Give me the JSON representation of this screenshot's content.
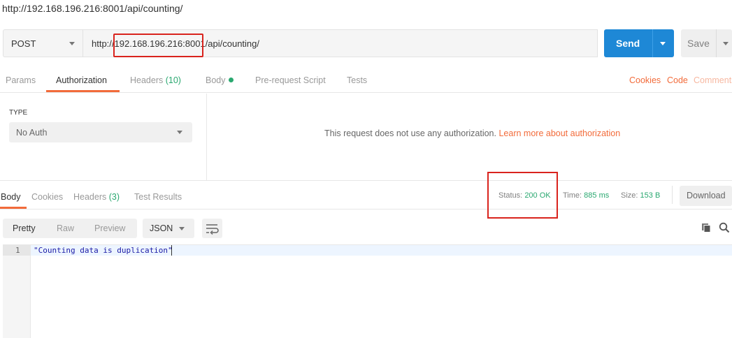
{
  "title_bar": {
    "text": "http://192.168.196.216:8001/api/counting/"
  },
  "request": {
    "method": "POST",
    "url_prefix": "http://",
    "url_host": "192.168.196.216:8001",
    "url_path": "/api/counting/",
    "send_label": "Send",
    "save_label": "Save"
  },
  "request_tabs": {
    "params": "Params",
    "authorization": "Authorization",
    "headers": "Headers",
    "headers_count": "(10)",
    "body": "Body",
    "prerequest": "Pre-request Script",
    "tests": "Tests",
    "cookies": "Cookies",
    "code": "Code",
    "comments": "Comments"
  },
  "auth": {
    "type_label": "TYPE",
    "type_value": "No Auth",
    "message": "This request does not use any authorization.",
    "learn_more": "Learn more about authorization"
  },
  "response_tabs": {
    "body": "Body",
    "cookies": "Cookies",
    "headers": "Headers",
    "headers_count": "(3)",
    "test_results": "Test Results"
  },
  "response_meta": {
    "status_label": "Status:",
    "status_value": "200 OK",
    "time_label": "Time:",
    "time_value": "885 ms",
    "size_label": "Size:",
    "size_value": "153 B",
    "download_label": "Download"
  },
  "view_toolbar": {
    "pretty": "Pretty",
    "raw": "Raw",
    "preview": "Preview",
    "format": "JSON"
  },
  "editor": {
    "lines": [
      {
        "number": "1",
        "text": "\"Counting data is duplication\""
      }
    ]
  },
  "colors": {
    "accent": "#f26b3a",
    "send_blue": "#1e88d6",
    "status_green": "#2aa870",
    "annotation_red": "#d9231d"
  }
}
